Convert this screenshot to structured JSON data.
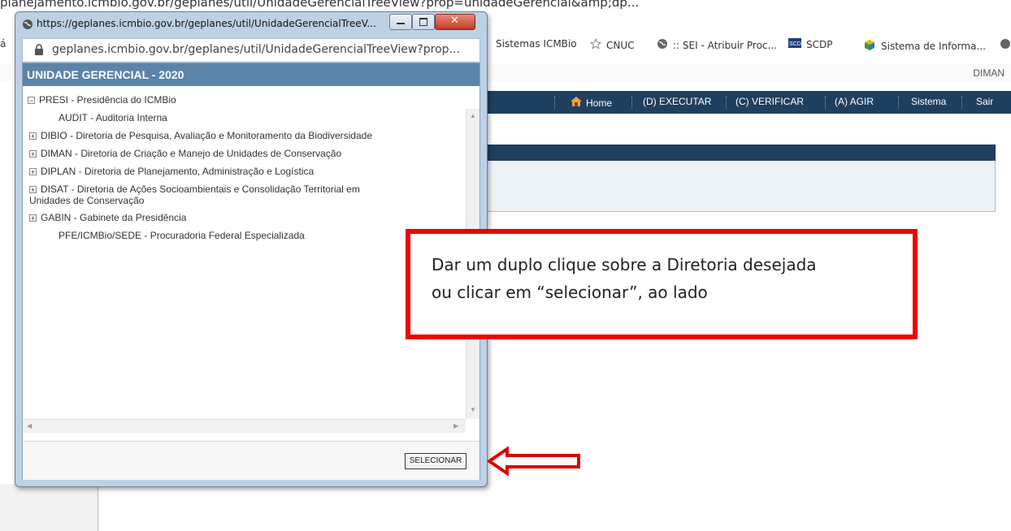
{
  "background": {
    "top_clipped_text": "planejamento.icmbio.gov.br/geplanes/util/UnidadeGerencialTreeView?prop=unidadeGerencial&amp;dp...",
    "bookmarks": [
      {
        "label": "á",
        "icon": "page-icon"
      },
      {
        "label": "Sistemas ICMBio",
        "icon": "none"
      },
      {
        "label": "CNUC",
        "icon": "star-icon"
      },
      {
        "label": ":: SEI - Atribuir Proc...",
        "icon": "globe-icon"
      },
      {
        "label": "SCDP",
        "icon": "scdp-icon"
      },
      {
        "label": "Sistema de Informa...",
        "icon": "box-icon"
      }
    ],
    "header_user": "DIMAN",
    "nav": [
      "Home",
      "(D) EXECUTAR",
      "(C) VERIFICAR",
      "(A) AGIR",
      "Sistema",
      "Sair"
    ]
  },
  "popup": {
    "window_title": "https://geplanes.icmbio.gov.br/geplanes/util/UnidadeGerencialTreeV...",
    "address": "geplanes.icmbio.gov.br/geplanes/util/UnidadeGerencialTreeView?prop...",
    "unit_title": "UNIDADE GERENCIAL - 2020",
    "tree": {
      "root": "PRESI - Presidência do ICMBio",
      "children": [
        {
          "label": "AUDIT - Auditoria Interna",
          "expandable": false
        },
        {
          "label": "DIBIO - Diretoria de Pesquisa, Avaliação e Monitoramento da Biodiversidade",
          "expandable": true
        },
        {
          "label": "DIMAN - Diretoria de Criação e Manejo de Unidades de Conservação",
          "expandable": true
        },
        {
          "label": "DIPLAN - Diretoria de Planejamento, Administração e Logística",
          "expandable": true
        },
        {
          "label": "DISAT - Diretoria de Ações Socioambientais e Consolidação Territorial em",
          "label_line2": "Unidades de Conservação",
          "expandable": true
        },
        {
          "label": "GABIN - Gabinete da Presidência",
          "expandable": true
        },
        {
          "label": "PFE/ICMBio/SEDE - Procuradoria Federal Especializada",
          "expandable": false
        }
      ]
    },
    "select_button": "SELECIONAR"
  },
  "annotation": {
    "line1": "Dar um duplo clique sobre a Diretoria desejada",
    "line2": "ou clicar em “selecionar”, ao lado",
    "color": "#ee0000"
  }
}
